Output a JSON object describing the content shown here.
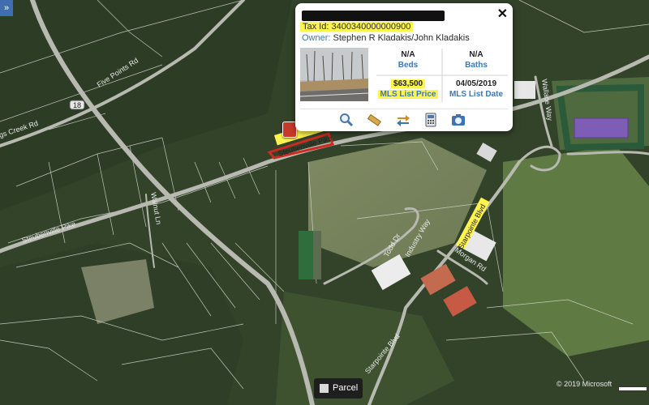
{
  "popup": {
    "tax_id": "Tax Id: 3400340000000900",
    "owner_label": "Owner:",
    "owner_name": "Stephen R Kladakis/John Kladakis",
    "beds_value": "N/A",
    "beds_label": "Beds",
    "baths_value": "N/A",
    "baths_label": "Baths",
    "price_value": "$63,500",
    "price_label": "MLS List Price",
    "date_value": "04/05/2019",
    "date_label": "MLS List Date",
    "close": "✕",
    "tools": [
      "zoom-icon",
      "measure-icon",
      "directions-icon",
      "calculator-icon",
      "photo-icon"
    ]
  },
  "map": {
    "roads": {
      "five_points": "Five Points Rd",
      "gs_creek": "gs Creek Rd",
      "route_18": "18",
      "steubenville_west": "Steubenville Pike",
      "steubenville_east": "Steubenville Pike",
      "walnut_ln": "Walnut Ln",
      "todd_dr": "Todd Dr",
      "industry_way": "Industry Way",
      "starpointe_blvd": "Starpointe Blvd",
      "starpointe_blvd_south": "Starpointe Blvd",
      "morgan_rd": "Morgan Rd",
      "wallace_way": "Wallace Way"
    },
    "expand_button": "»",
    "legend_label": "Parcel",
    "copyright": "© 2019 Microsoft"
  },
  "colors": {
    "highlight": "#fff44f",
    "label_blue": "#3a78b8",
    "parcel_line": "#d8dcd4",
    "selected_parcel": "#d02a20"
  }
}
